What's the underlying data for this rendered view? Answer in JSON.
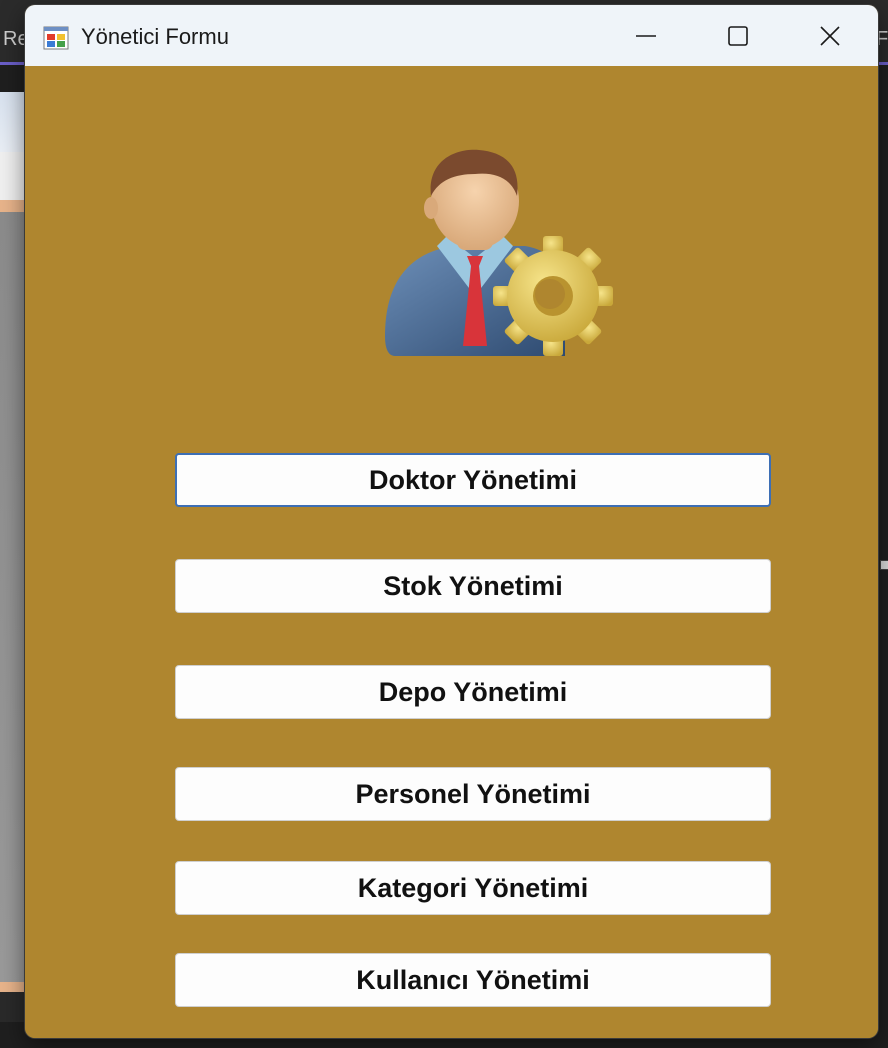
{
  "window": {
    "title": "Yönetici Formu"
  },
  "background": {
    "left_text": "Re",
    "right_text": "Fo"
  },
  "menu": {
    "buttons": [
      {
        "label": "Doktor Yönetimi"
      },
      {
        "label": "Stok Yönetimi"
      },
      {
        "label": "Depo Yönetimi"
      },
      {
        "label": "Personel Yönetimi"
      },
      {
        "label": "Kategori Yönetimi"
      },
      {
        "label": "Kullanıcı Yönetimi"
      }
    ]
  },
  "icons": {
    "app": "form-app-icon",
    "admin": "admin-user-gear-icon",
    "minimize": "minimize-icon",
    "maximize": "maximize-icon",
    "close": "close-icon"
  },
  "colors": {
    "form_background": "#af862f",
    "titlebar": "#eff4f9",
    "button_background": "#fdfdfd",
    "focus_border": "#3d6fb5"
  }
}
